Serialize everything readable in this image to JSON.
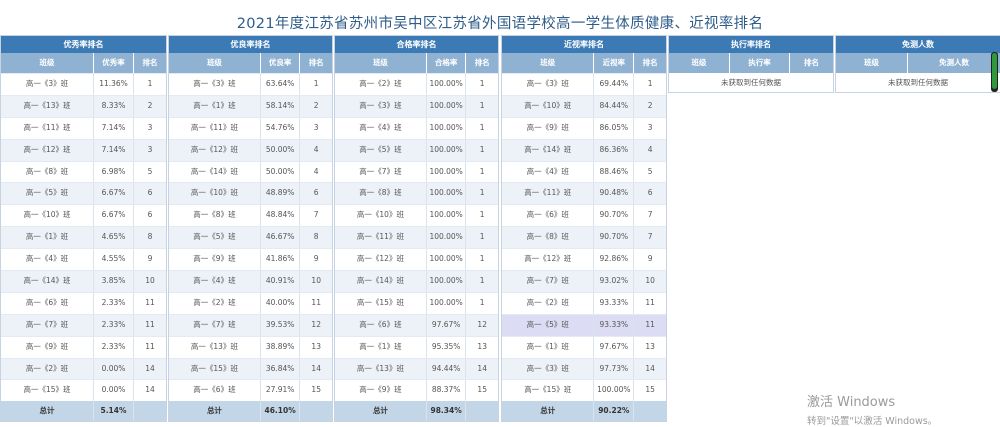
{
  "title": "2021年度江苏省苏州市吴中区江苏省外国语学校高一学生体质健康、近视率排名",
  "colors": {
    "header": "#3b7ab5",
    "subheader": "#8fb2d2",
    "title": "#2f5d8a",
    "highlight": "#dcdcf4"
  },
  "panels": [
    {
      "title": "优秀率排名",
      "cols": [
        "班级",
        "优秀率",
        "排名"
      ],
      "rows": [
        [
          "高一《3》班",
          "11.36%",
          "1"
        ],
        [
          "高一《13》班",
          "8.33%",
          "2"
        ],
        [
          "高一《11》班",
          "7.14%",
          "3"
        ],
        [
          "高一《12》班",
          "7.14%",
          "3"
        ],
        [
          "高一《8》班",
          "6.98%",
          "5"
        ],
        [
          "高一《5》班",
          "6.67%",
          "6"
        ],
        [
          "高一《10》班",
          "6.67%",
          "6"
        ],
        [
          "高一《1》班",
          "4.65%",
          "8"
        ],
        [
          "高一《4》班",
          "4.55%",
          "9"
        ],
        [
          "高一《14》班",
          "3.85%",
          "10"
        ],
        [
          "高一《6》班",
          "2.33%",
          "11"
        ],
        [
          "高一《7》班",
          "2.33%",
          "11"
        ],
        [
          "高一《9》班",
          "2.33%",
          "11"
        ],
        [
          "高一《2》班",
          "0.00%",
          "14"
        ],
        [
          "高一《15》班",
          "0.00%",
          "14"
        ]
      ],
      "total": [
        "总计",
        "5.14%",
        ""
      ]
    },
    {
      "title": "优良率排名",
      "cols": [
        "班级",
        "优良率",
        "排名"
      ],
      "rows": [
        [
          "高一《3》班",
          "63.64%",
          "1"
        ],
        [
          "高一《1》班",
          "58.14%",
          "2"
        ],
        [
          "高一《11》班",
          "54.76%",
          "3"
        ],
        [
          "高一《12》班",
          "50.00%",
          "4"
        ],
        [
          "高一《14》班",
          "50.00%",
          "4"
        ],
        [
          "高一《10》班",
          "48.89%",
          "6"
        ],
        [
          "高一《8》班",
          "48.84%",
          "7"
        ],
        [
          "高一《5》班",
          "46.67%",
          "8"
        ],
        [
          "高一《9》班",
          "41.86%",
          "9"
        ],
        [
          "高一《4》班",
          "40.91%",
          "10"
        ],
        [
          "高一《2》班",
          "40.00%",
          "11"
        ],
        [
          "高一《7》班",
          "39.53%",
          "12"
        ],
        [
          "高一《13》班",
          "38.89%",
          "13"
        ],
        [
          "高一《15》班",
          "36.84%",
          "14"
        ],
        [
          "高一《6》班",
          "27.91%",
          "15"
        ]
      ],
      "total": [
        "总计",
        "46.10%",
        ""
      ]
    },
    {
      "title": "合格率排名",
      "cols": [
        "班级",
        "合格率",
        "排名"
      ],
      "rows": [
        [
          "高一《2》班",
          "100.00%",
          "1"
        ],
        [
          "高一《3》班",
          "100.00%",
          "1"
        ],
        [
          "高一《4》班",
          "100.00%",
          "1"
        ],
        [
          "高一《5》班",
          "100.00%",
          "1"
        ],
        [
          "高一《7》班",
          "100.00%",
          "1"
        ],
        [
          "高一《8》班",
          "100.00%",
          "1"
        ],
        [
          "高一《10》班",
          "100.00%",
          "1"
        ],
        [
          "高一《11》班",
          "100.00%",
          "1"
        ],
        [
          "高一《12》班",
          "100.00%",
          "1"
        ],
        [
          "高一《14》班",
          "100.00%",
          "1"
        ],
        [
          "高一《15》班",
          "100.00%",
          "1"
        ],
        [
          "高一《6》班",
          "97.67%",
          "12"
        ],
        [
          "高一《1》班",
          "95.35%",
          "13"
        ],
        [
          "高一《13》班",
          "94.44%",
          "14"
        ],
        [
          "高一《9》班",
          "88.37%",
          "15"
        ]
      ],
      "total": [
        "总计",
        "98.34%",
        ""
      ]
    },
    {
      "title": "近视率排名",
      "cols": [
        "班级",
        "近视率",
        "排名"
      ],
      "rows": [
        [
          "高一《3》班",
          "69.44%",
          "1"
        ],
        [
          "高一《10》班",
          "84.44%",
          "2"
        ],
        [
          "高一《9》班",
          "86.05%",
          "3"
        ],
        [
          "高一《14》班",
          "86.36%",
          "4"
        ],
        [
          "高一《4》班",
          "88.46%",
          "5"
        ],
        [
          "高一《11》班",
          "90.48%",
          "6"
        ],
        [
          "高一《6》班",
          "90.70%",
          "7"
        ],
        [
          "高一《8》班",
          "90.70%",
          "7"
        ],
        [
          "高一《12》班",
          "92.86%",
          "9"
        ],
        [
          "高一《7》班",
          "93.02%",
          "10"
        ],
        [
          "高一《2》班",
          "93.33%",
          "11"
        ],
        [
          "高一《5》班",
          "93.33%",
          "11"
        ],
        [
          "高一《1》班",
          "97.67%",
          "13"
        ],
        [
          "高一《3》班",
          "97.73%",
          "14"
        ],
        [
          "高一《15》班",
          "100.00%",
          "15"
        ]
      ],
      "highlight_row": 11,
      "total": [
        "总计",
        "90.22%",
        ""
      ]
    }
  ],
  "exec_panel": {
    "title": "执行率排名",
    "cols": [
      "班级",
      "执行率",
      "排名"
    ],
    "empty": "未获取到任何数据"
  },
  "exempt_panel": {
    "title": "免测人数",
    "cols": [
      "班级",
      "免测人数"
    ],
    "empty": "未获取到任何数据"
  },
  "watermark": {
    "title": "激活 Windows",
    "sub": "转到\"设置\"以激活 Windows。"
  }
}
